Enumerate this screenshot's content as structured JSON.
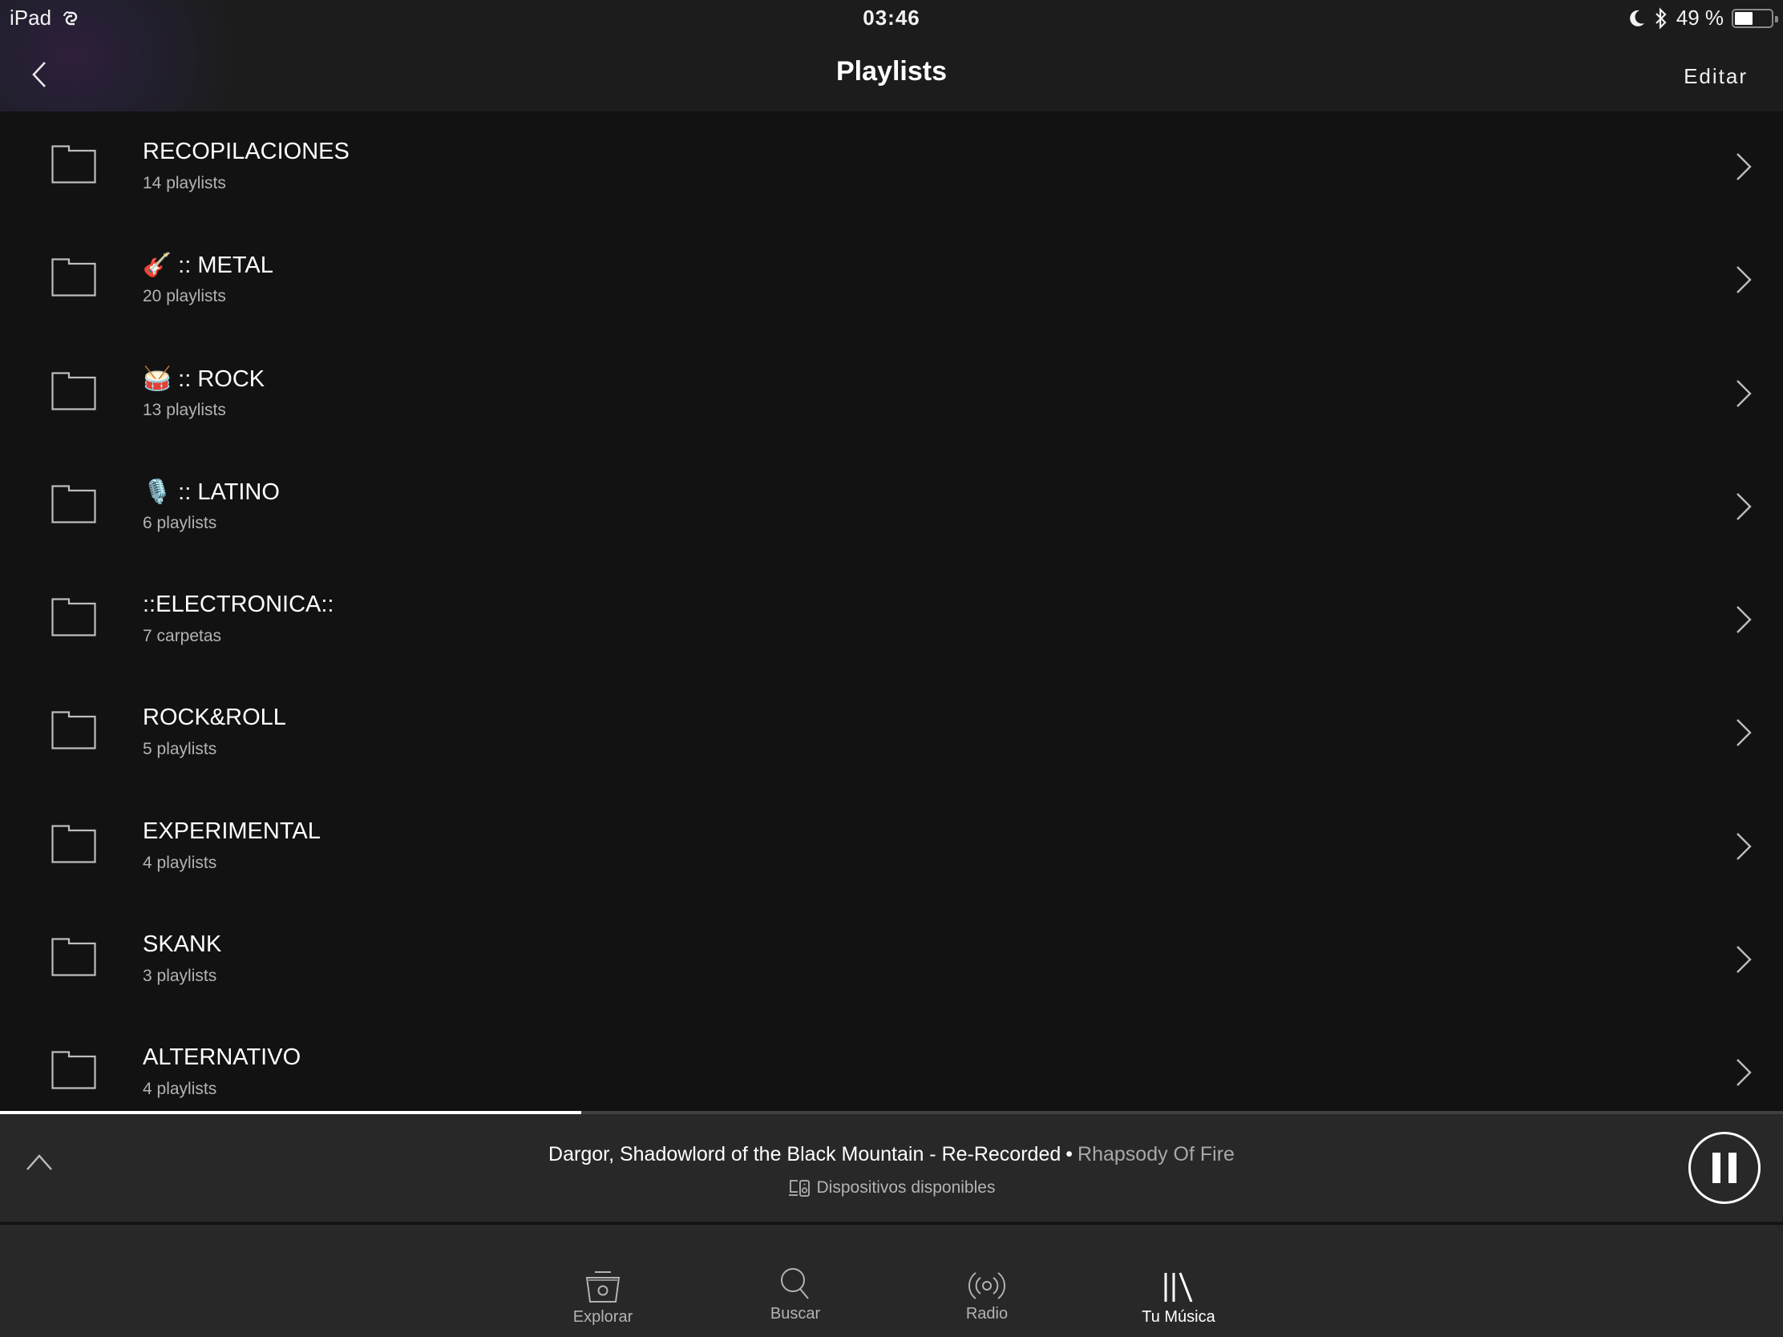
{
  "status_bar": {
    "device": "iPad",
    "time": "03:46",
    "battery_percent_label": "49 %",
    "battery_level": 0.49,
    "icons": [
      "hotspot-link-icon",
      "moon-icon",
      "bluetooth-icon",
      "battery-icon"
    ]
  },
  "nav": {
    "title": "Playlists",
    "back_icon": "chevron-left-icon",
    "edit_label": "Editar"
  },
  "folders": [
    {
      "title": "RECOPILACIONES",
      "subtitle": "14 playlists"
    },
    {
      "title": "🎸 ::  METAL",
      "subtitle": "20 playlists"
    },
    {
      "title": "🥁 :: ROCK",
      "subtitle": "13 playlists"
    },
    {
      "title": "🎙️ :: LATINO",
      "subtitle": "6 playlists"
    },
    {
      "title": "::ELECTRONICA::",
      "subtitle": "7 carpetas"
    },
    {
      "title": "ROCK&ROLL",
      "subtitle": "5 playlists"
    },
    {
      "title": "EXPERIMENTAL",
      "subtitle": "4 playlists"
    },
    {
      "title": "SKANK",
      "subtitle": "3 playlists"
    },
    {
      "title": "ALTERNATIVO",
      "subtitle": "4 playlists"
    }
  ],
  "player": {
    "progress": 0.326,
    "track_title": "Dargor, Shadowlord of the Black Mountain - Re-Recorded",
    "separator": "•",
    "artist": "Rhapsody Of Fire",
    "devices_label": "Dispositivos disponibles",
    "state": "playing"
  },
  "tabs": [
    {
      "label": "Explorar",
      "icon": "browse-icon",
      "active": false
    },
    {
      "label": "Buscar",
      "icon": "search-icon",
      "active": false
    },
    {
      "label": "Radio",
      "icon": "radio-icon",
      "active": false
    },
    {
      "label": "Tu Música",
      "icon": "library-icon",
      "active": true
    }
  ],
  "colors": {
    "background": "#121212",
    "header": "#1b1b1b",
    "player_bar": "#282828",
    "subtitle_text": "#b3b3b3",
    "artist_text": "#a8a8a8"
  }
}
